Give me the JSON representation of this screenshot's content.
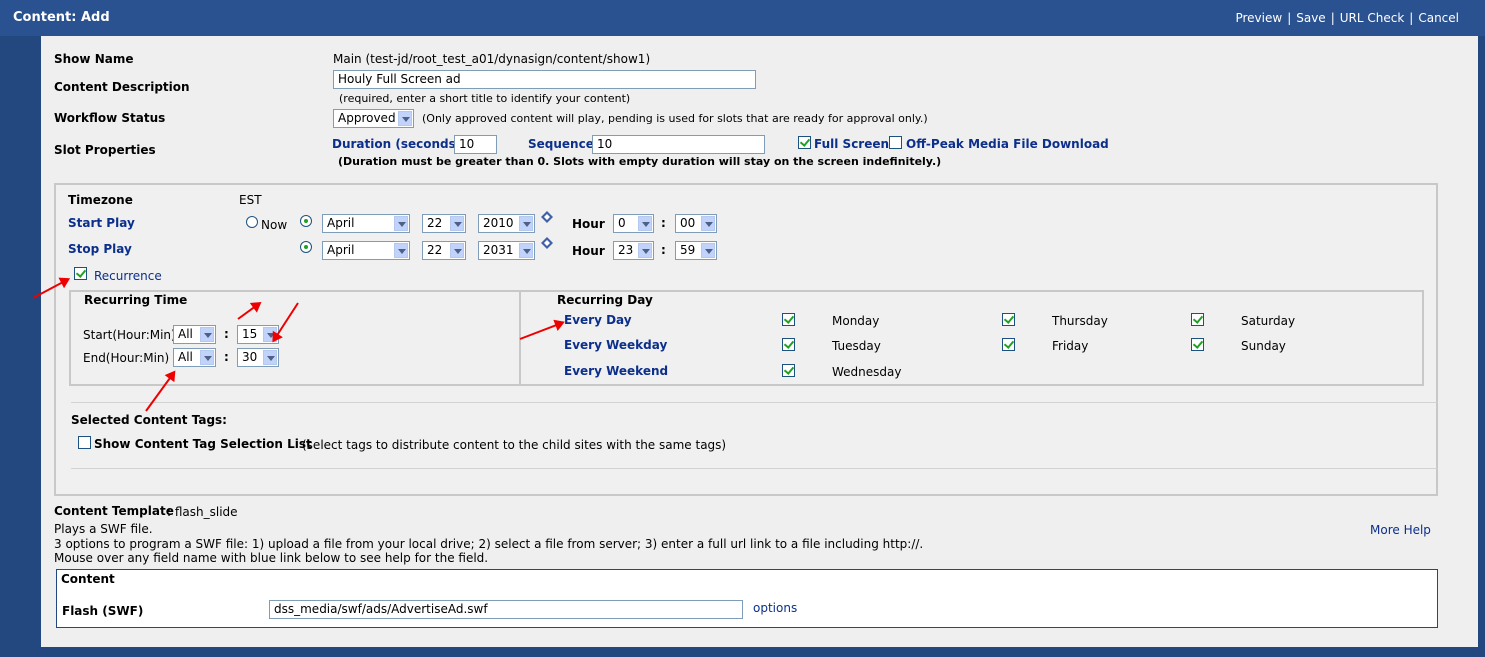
{
  "title": "Content: Add",
  "toplinks": [
    "Preview",
    "Save",
    "URL Check",
    "Cancel"
  ],
  "show_name": {
    "label": "Show Name",
    "value": "Main (test-jd/root_test_a01/dynasign/content/show1)"
  },
  "content_description": {
    "label": "Content Description",
    "value": "Houly Full Screen ad",
    "hint": "(required, enter a short title to identify your content)"
  },
  "workflow": {
    "label": "Workflow Status",
    "value": "Approved",
    "hint": "(Only approved content will play, pending is used for slots that are ready for approval only.)"
  },
  "slot": {
    "label": "Slot Properties",
    "duration_label": "Duration (seconds)",
    "duration_value": "10",
    "sequence_label": "Sequence",
    "sequence_value": "10",
    "full_screen_label": "Full Screen",
    "full_screen_checked": true,
    "offpeak_label": "Off-Peak Media File Download",
    "offpeak_checked": false,
    "hint": "(Duration must be greater than 0. Slots with empty duration will stay on the screen indefinitely.)"
  },
  "schedule": {
    "timezone_label": "Timezone",
    "timezone_value": "EST",
    "start_label": "Start Play",
    "now_label": "Now",
    "start": {
      "month": "April",
      "day": "22",
      "year": "2010",
      "hour_label": "Hour",
      "hour": "0",
      "minute": "00"
    },
    "stop_label": "Stop Play",
    "stop": {
      "month": "April",
      "day": "22",
      "year": "2031",
      "hour_label": "Hour",
      "hour": "23",
      "minute": "59"
    },
    "recurrence_label": "Recurrence",
    "recurrence_checked": true
  },
  "recurring_time": {
    "title": "Recurring Time",
    "start_label": "Start(Hour:Min)",
    "start_hour": "All",
    "start_min": "15",
    "end_label": "End(Hour:Min)",
    "end_hour": "All",
    "end_min": "30",
    "colon": ":"
  },
  "recurring_day": {
    "title": "Recurring Day",
    "every_day": "Every Day",
    "every_weekday": "Every Weekday",
    "every_weekend": "Every Weekend",
    "days": [
      {
        "name": "Monday",
        "checked": true
      },
      {
        "name": "Tuesday",
        "checked": true
      },
      {
        "name": "Wednesday",
        "checked": true
      },
      {
        "name": "Thursday",
        "checked": true
      },
      {
        "name": "Friday",
        "checked": true
      },
      {
        "name": "Saturday",
        "checked": true
      },
      {
        "name": "Sunday",
        "checked": true
      }
    ]
  },
  "tags": {
    "title": "Selected Content Tags:",
    "show_list_label": "Show Content Tag Selection List",
    "show_list_hint": "(select tags to distribute content to the child sites with the same tags)"
  },
  "template": {
    "label": "Content Template",
    "value": ": flash_slide",
    "line1": "Plays a SWF file.",
    "line2": "3 options to program a SWF file: 1) upload a file from your local drive; 2) select a file from server; 3) enter a full url link to a file including http://.",
    "line3": "Mouse over any field name with blue link below to see help for the field.",
    "more_help": "More Help"
  },
  "content_panel": {
    "title": "Content",
    "flash_label": "Flash (SWF)",
    "flash_value": "dss_media/swf/ads/AdvertiseAd.swf",
    "options_label": "options"
  },
  "colors": {
    "titlebar": "#2a5190",
    "frame": "#23477f",
    "link": "#0b2f8a",
    "annotation_arrow": "#e00000"
  }
}
